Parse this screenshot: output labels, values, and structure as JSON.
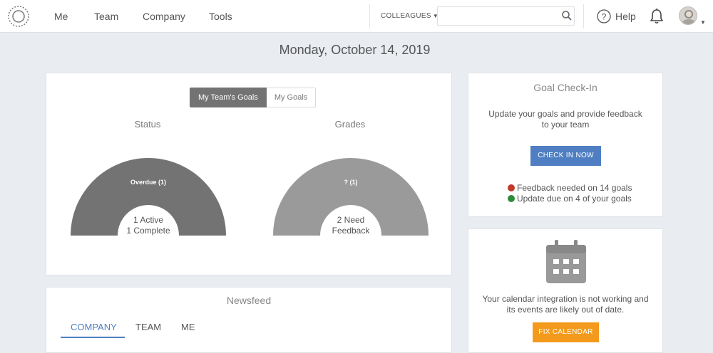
{
  "nav": {
    "items": [
      {
        "label": "Me"
      },
      {
        "label": "Team"
      },
      {
        "label": "Company"
      },
      {
        "label": "Tools"
      }
    ],
    "colleagues_label": "COLLEAGUES",
    "search_placeholder": "",
    "help_label": "Help"
  },
  "page": {
    "date": "Monday, October 14, 2019"
  },
  "goals": {
    "tabs": [
      {
        "label": "My Team's Goals",
        "active": true
      },
      {
        "label": "My Goals",
        "active": false
      }
    ],
    "status_chart": {
      "title": "Status",
      "arc_label": "Overdue (1)",
      "center_line1": "1 Active",
      "center_line2": "1 Complete"
    },
    "grades_chart": {
      "title": "Grades",
      "arc_label": "? (1)",
      "center_line1": "2 Need",
      "center_line2": "Feedback"
    }
  },
  "checkin": {
    "title": "Goal Check-In",
    "description_line1": "Update your goals and provide feedback",
    "description_line2": "to your team",
    "button_label": "CHECK IN NOW",
    "feedback_needed": "Feedback needed on 14 goals",
    "update_due": "Update due on 4 of your goals"
  },
  "calendar": {
    "message_line1": "Your calendar integration is not working and",
    "message_line2": "its events are likely out of date.",
    "button_label": "FIX CALENDAR"
  },
  "newsfeed": {
    "title": "Newsfeed",
    "tabs": [
      {
        "label": "COMPANY",
        "active": true
      },
      {
        "label": "TEAM",
        "active": false
      },
      {
        "label": "ME",
        "active": false
      }
    ]
  },
  "colors": {
    "primary": "#4f7fc2",
    "orange": "#f39a1c",
    "status_arc": "#737373",
    "grades_arc": "#9a9a9a",
    "feedback_dot": "#c0392b",
    "update_dot": "#2e8b3a"
  }
}
